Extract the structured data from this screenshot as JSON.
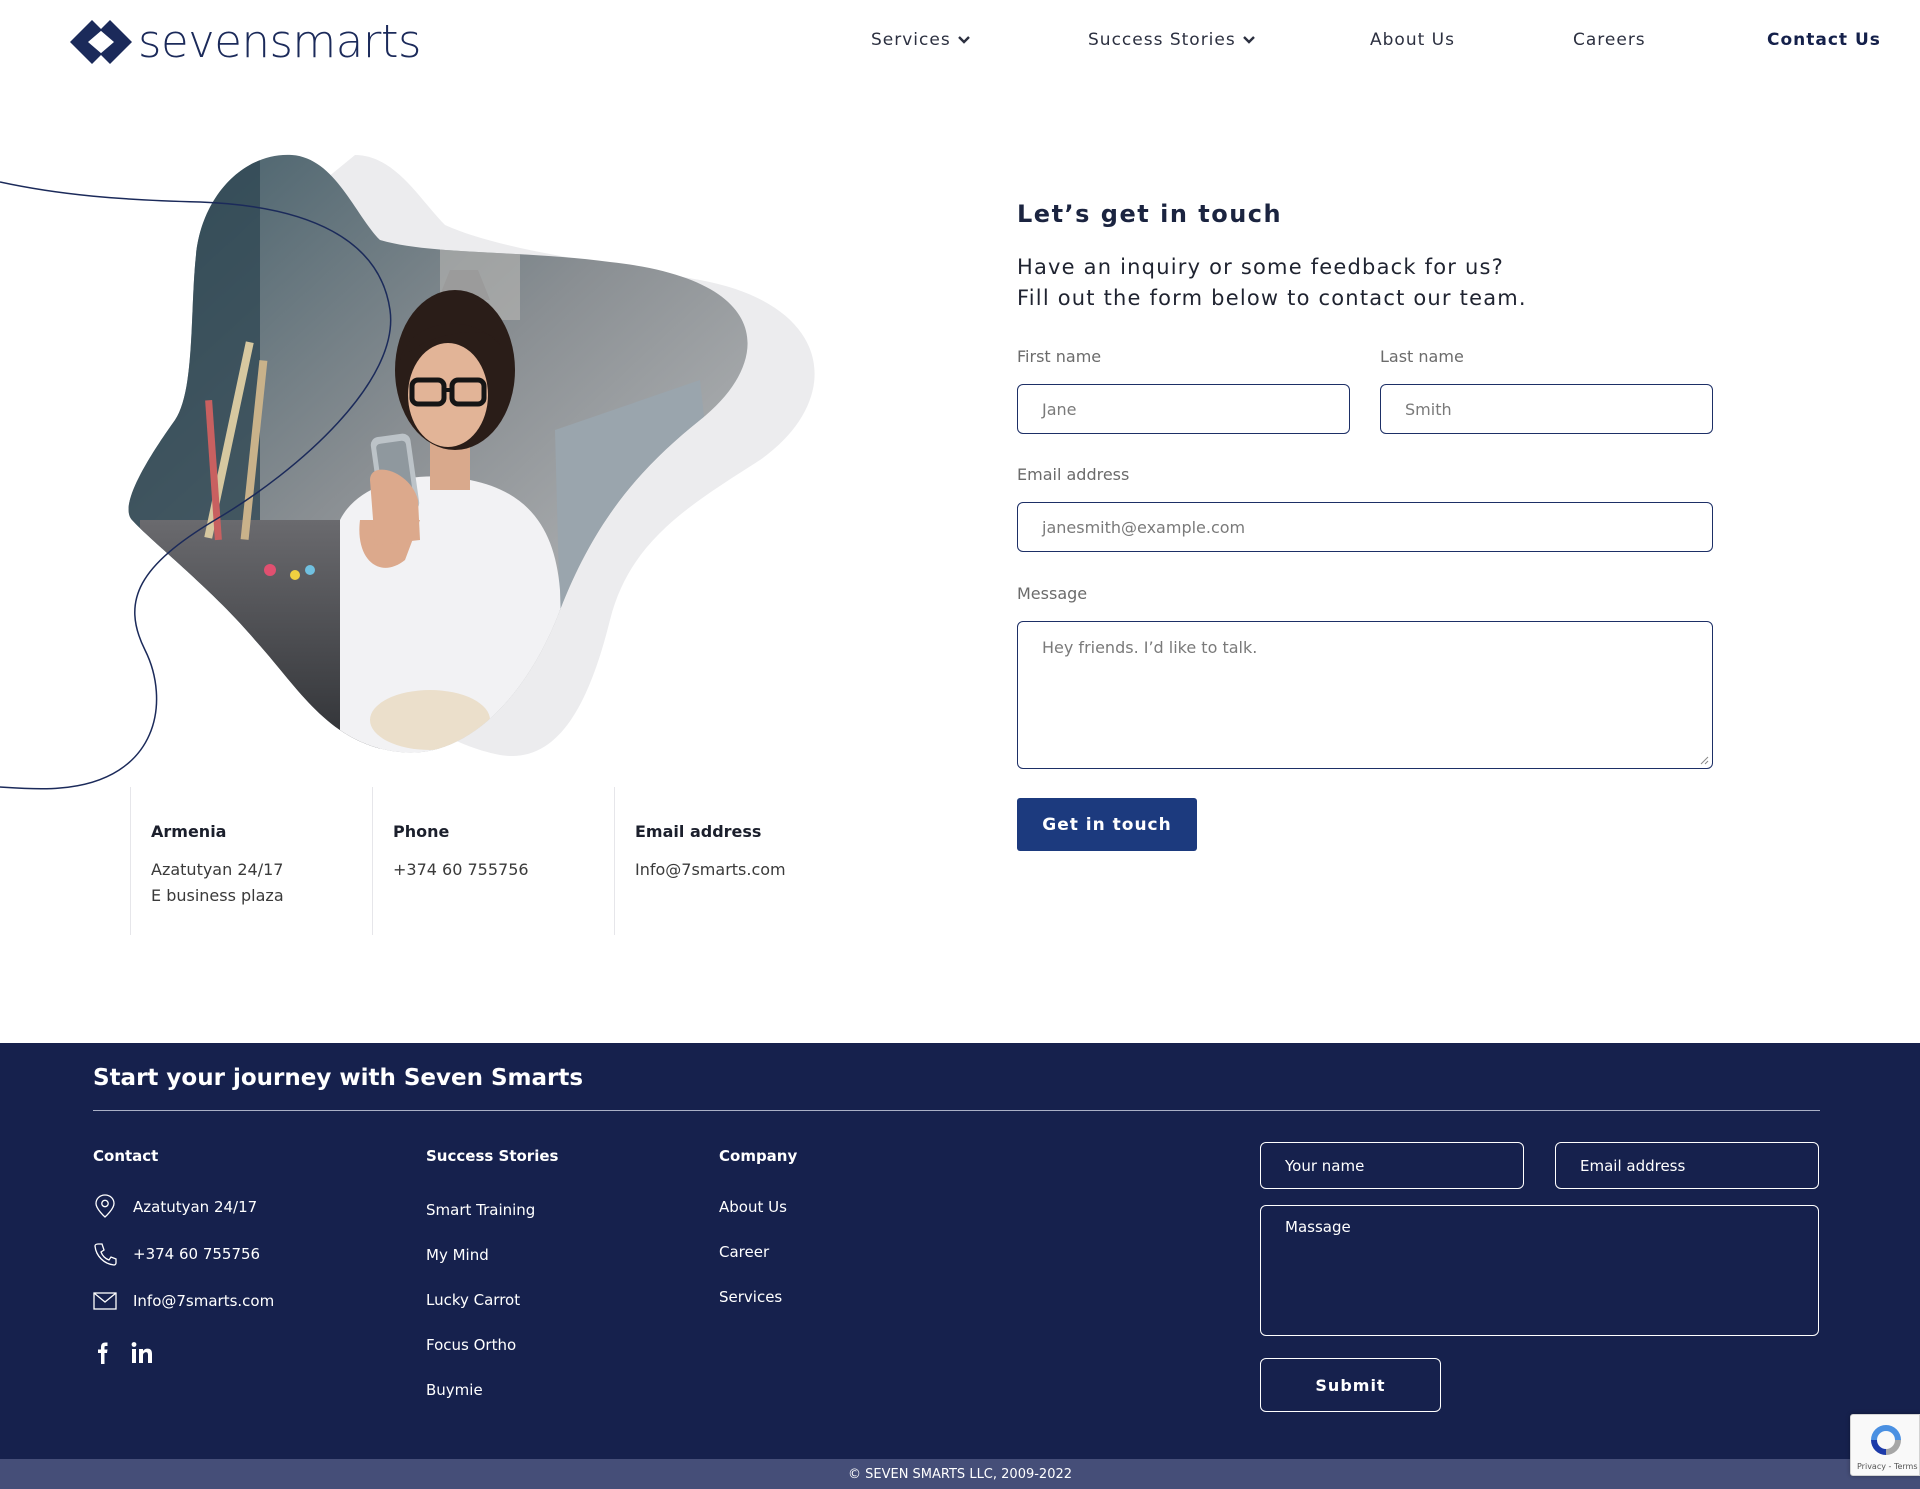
{
  "brand": {
    "logo_text": "sevensmarts",
    "logo_color": "#1b2a5a"
  },
  "nav": {
    "services": "Services",
    "success_stories": "Success Stories",
    "about_us": "About Us",
    "careers": "Careers",
    "contact_us": "Contact Us"
  },
  "contact_form": {
    "title": "Let’s get in touch",
    "subtitle_line1": "Have an inquiry or some feedback for us?",
    "subtitle_line2": "Fill out the form below to contact our team.",
    "first_name_label": "First name",
    "first_name_placeholder": "Jane",
    "last_name_label": "Last name",
    "last_name_placeholder": "Smith",
    "email_label": "Email address",
    "email_placeholder": "janesmith@example.com",
    "message_label": "Message",
    "message_placeholder": "Hey friends. I’d like to talk.",
    "submit_label": "Get in touch",
    "accent_color": "#1c3a7e"
  },
  "contact_info": {
    "location": {
      "heading": "Armenia",
      "line1": "Azatutyan 24/17",
      "line2": "E business plaza"
    },
    "phone": {
      "heading": "Phone",
      "value": "+374 60 755756"
    },
    "email": {
      "heading": "Email address",
      "value": "Info@7smarts.com"
    }
  },
  "footer": {
    "title": "Start your journey with Seven Smarts",
    "background_color": "#16214d",
    "contact": {
      "heading": "Contact",
      "address": "Azatutyan 24/17",
      "phone": "+374 60 755756",
      "email": "Info@7smarts.com"
    },
    "social": [
      "facebook-icon",
      "linkedin-icon"
    ],
    "success_stories": {
      "heading": "Success Stories",
      "items": [
        "Smart Training",
        "My Mind",
        "Lucky Carrot",
        "Focus Ortho",
        "Buymie"
      ]
    },
    "company": {
      "heading": "Company",
      "items": [
        "About Us",
        "Career",
        "Services"
      ]
    },
    "form": {
      "name_placeholder": "Your name",
      "email_placeholder": "Email address",
      "message_placeholder": "Massage",
      "submit_label": "Submit"
    }
  },
  "copyright": "© SEVEN SMARTS LLC, 2009-2022",
  "recaptcha": {
    "links": "Privacy - Terms"
  }
}
